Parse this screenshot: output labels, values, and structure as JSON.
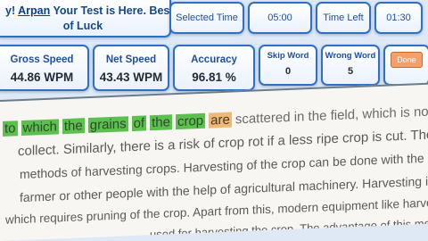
{
  "header": {
    "greeting_prefix": "y!",
    "user_name": "Arpan",
    "greeting_rest": "Your Test is Here. Best",
    "greeting_line2": "of Luck"
  },
  "timer": {
    "selected_label": "Selected Time",
    "selected_value": "05:00 Minutes",
    "left_label": "Time Left",
    "left_value": "01:30"
  },
  "stats": {
    "gross_speed_label": "Gross Speed",
    "gross_speed_value": "44.86 WPM",
    "net_speed_label": "Net Speed",
    "net_speed_value": "43.43 WPM",
    "accuracy_label": "Accuracy",
    "accuracy_value": "96.81 %",
    "skip_label": "Skip Word",
    "skip_value": "0",
    "wrong_label": "Wrong Word",
    "wrong_value": "5",
    "done_label": "Done"
  },
  "passage": {
    "typed_words": [
      "to",
      "which",
      "the",
      "grains",
      "of",
      "the",
      "crop"
    ],
    "current_word": "are",
    "line1_rest": "scattered in the field, which is not possible to",
    "line2": "collect. Similarly, there is a risk of crop rot if a less ripe crop is cut. There are man",
    "line3": "methods of harvesting crops. Harvesting of the crop can be done with the help o",
    "line4": "farmer or other people with the help of agricultural machinery. Harvesting in th",
    "line5": "which requires pruning of the crop. Apart from this, modern equipment like harves",
    "line6": "used for harvesting the crop. The advantage of this method"
  },
  "colors": {
    "accent_blue": "#2f6fc4",
    "typed_highlight": "#5cc04f",
    "current_highlight": "#f0b878",
    "done_button": "#f5a06b"
  }
}
